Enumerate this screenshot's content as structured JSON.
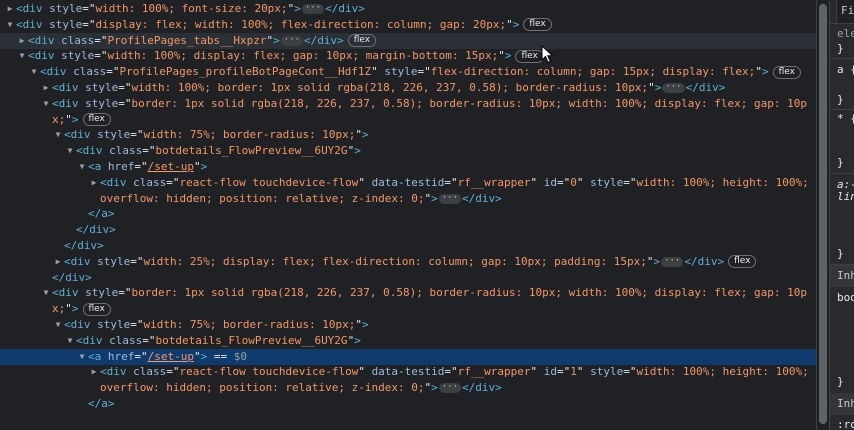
{
  "elements_tree": {
    "lines": [
      {
        "indent": 0,
        "arrow": "right",
        "parts": [
          {
            "t": "tag",
            "v": "<div "
          },
          {
            "t": "an",
            "v": "style"
          },
          {
            "t": "eq",
            "v": "=\""
          },
          {
            "t": "av",
            "v": "width: 100%; font-size: 20px;"
          },
          {
            "t": "eq",
            "v": "\""
          },
          {
            "t": "tag",
            "v": ">"
          },
          {
            "t": "ell",
            "v": "···"
          },
          {
            "t": "tag",
            "v": "</div>"
          }
        ]
      },
      {
        "indent": 0,
        "arrow": "down",
        "parts": [
          {
            "t": "tag",
            "v": "<div "
          },
          {
            "t": "an",
            "v": "style"
          },
          {
            "t": "eq",
            "v": "=\""
          },
          {
            "t": "av",
            "v": "display: flex; width: 100%; flex-direction: column; gap: 20px;"
          },
          {
            "t": "eq",
            "v": "\""
          },
          {
            "t": "tag",
            "v": ">"
          },
          {
            "t": "badge",
            "v": "flex"
          }
        ]
      },
      {
        "indent": 1,
        "arrow": "right",
        "hover": true,
        "parts": [
          {
            "t": "tag",
            "v": "<div "
          },
          {
            "t": "an",
            "v": "class"
          },
          {
            "t": "eq",
            "v": "=\""
          },
          {
            "t": "av",
            "v": "ProfilePages_tabs__Hxpzr"
          },
          {
            "t": "eq",
            "v": "\""
          },
          {
            "t": "tag",
            "v": ">"
          },
          {
            "t": "ell",
            "v": "···"
          },
          {
            "t": "tag",
            "v": "</div>"
          },
          {
            "t": "badge",
            "v": "flex"
          }
        ]
      },
      {
        "indent": 1,
        "arrow": "down",
        "parts": [
          {
            "t": "tag",
            "v": "<div "
          },
          {
            "t": "an",
            "v": "style"
          },
          {
            "t": "eq",
            "v": "=\""
          },
          {
            "t": "av",
            "v": "width: 100%; display: flex; gap: 10px; margin-bottom: 15px;"
          },
          {
            "t": "eq",
            "v": "\""
          },
          {
            "t": "tag",
            "v": ">"
          },
          {
            "t": "badge",
            "v": "flex"
          }
        ]
      },
      {
        "indent": 2,
        "arrow": "down",
        "parts": [
          {
            "t": "tag",
            "v": "<div "
          },
          {
            "t": "an",
            "v": "class"
          },
          {
            "t": "eq",
            "v": "=\""
          },
          {
            "t": "av",
            "v": "ProfilePages_profileBotPageCont__Hdf1Z"
          },
          {
            "t": "eq",
            "v": "\" "
          },
          {
            "t": "an",
            "v": "style"
          },
          {
            "t": "eq",
            "v": "=\""
          },
          {
            "t": "av",
            "v": "flex-direction: column; gap: 15px; display: flex;"
          },
          {
            "t": "eq",
            "v": "\""
          },
          {
            "t": "tag",
            "v": ">"
          },
          {
            "t": "badge",
            "v": "flex"
          }
        ]
      },
      {
        "indent": 3,
        "arrow": "right",
        "parts": [
          {
            "t": "tag",
            "v": "<div "
          },
          {
            "t": "an",
            "v": "style"
          },
          {
            "t": "eq",
            "v": "=\""
          },
          {
            "t": "av",
            "v": "width: 100%; border: 1px solid rgba(218, 226, 237, 0.58); border-radius: 10px;"
          },
          {
            "t": "eq",
            "v": "\""
          },
          {
            "t": "tag",
            "v": ">"
          },
          {
            "t": "ell",
            "v": "···"
          },
          {
            "t": "tag",
            "v": "</div>"
          }
        ]
      },
      {
        "indent": 3,
        "arrow": "down",
        "parts": [
          {
            "t": "tag",
            "v": "<div "
          },
          {
            "t": "an",
            "v": "style"
          },
          {
            "t": "eq",
            "v": "=\""
          },
          {
            "t": "av",
            "v": "border: 1px solid rgba(218, 226, 237, 0.58); border-radius: 10px; width: 100%; display: flex; gap: 10p"
          }
        ]
      },
      {
        "indent": 3,
        "cont": true,
        "parts": [
          {
            "t": "av",
            "v": "x;"
          },
          {
            "t": "eq",
            "v": "\""
          },
          {
            "t": "tag",
            "v": ">"
          },
          {
            "t": "badge",
            "v": "flex"
          }
        ]
      },
      {
        "indent": 4,
        "arrow": "down",
        "parts": [
          {
            "t": "tag",
            "v": "<div "
          },
          {
            "t": "an",
            "v": "style"
          },
          {
            "t": "eq",
            "v": "=\""
          },
          {
            "t": "av",
            "v": "width: 75%; border-radius: 10px;"
          },
          {
            "t": "eq",
            "v": "\""
          },
          {
            "t": "tag",
            "v": ">"
          }
        ]
      },
      {
        "indent": 5,
        "arrow": "down",
        "parts": [
          {
            "t": "tag",
            "v": "<div "
          },
          {
            "t": "an",
            "v": "class"
          },
          {
            "t": "eq",
            "v": "=\""
          },
          {
            "t": "av",
            "v": "botdetails_FlowPreview__6UY2G"
          },
          {
            "t": "eq",
            "v": "\""
          },
          {
            "t": "tag",
            "v": ">"
          }
        ]
      },
      {
        "indent": 6,
        "arrow": "down",
        "parts": [
          {
            "t": "tag",
            "v": "<a "
          },
          {
            "t": "an",
            "v": "href"
          },
          {
            "t": "eq",
            "v": "=\""
          },
          {
            "t": "lnk",
            "v": "/set-up"
          },
          {
            "t": "eq",
            "v": "\""
          },
          {
            "t": "tag",
            "v": ">"
          }
        ]
      },
      {
        "indent": 7,
        "arrow": "right",
        "parts": [
          {
            "t": "tag",
            "v": "<div "
          },
          {
            "t": "an",
            "v": "class"
          },
          {
            "t": "eq",
            "v": "=\""
          },
          {
            "t": "av",
            "v": "react-flow touchdevice-flow"
          },
          {
            "t": "eq",
            "v": "\" "
          },
          {
            "t": "an",
            "v": "data-testid"
          },
          {
            "t": "eq",
            "v": "=\""
          },
          {
            "t": "av",
            "v": "rf__wrapper"
          },
          {
            "t": "eq",
            "v": "\" "
          },
          {
            "t": "an",
            "v": "id"
          },
          {
            "t": "eq",
            "v": "=\""
          },
          {
            "t": "av",
            "v": "0"
          },
          {
            "t": "eq",
            "v": "\" "
          },
          {
            "t": "an",
            "v": "style"
          },
          {
            "t": "eq",
            "v": "=\""
          },
          {
            "t": "av",
            "v": "width: 100%; height: 100%;"
          }
        ]
      },
      {
        "indent": 7,
        "cont": true,
        "parts": [
          {
            "t": "av",
            "v": "overflow: hidden; position: relative; z-index: 0;"
          },
          {
            "t": "eq",
            "v": "\""
          },
          {
            "t": "tag",
            "v": ">"
          },
          {
            "t": "ell",
            "v": "···"
          },
          {
            "t": "tag",
            "v": "</div>"
          }
        ]
      },
      {
        "indent": 6,
        "parts": [
          {
            "t": "tag",
            "v": "</a>"
          }
        ]
      },
      {
        "indent": 5,
        "parts": [
          {
            "t": "tag",
            "v": "</div>"
          }
        ]
      },
      {
        "indent": 4,
        "parts": [
          {
            "t": "tag",
            "v": "</div>"
          }
        ]
      },
      {
        "indent": 4,
        "arrow": "right",
        "parts": [
          {
            "t": "tag",
            "v": "<div "
          },
          {
            "t": "an",
            "v": "style"
          },
          {
            "t": "eq",
            "v": "=\""
          },
          {
            "t": "av",
            "v": "width: 25%; display: flex; flex-direction: column; gap: 10px; padding: 15px;"
          },
          {
            "t": "eq",
            "v": "\""
          },
          {
            "t": "tag",
            "v": ">"
          },
          {
            "t": "ell",
            "v": "···"
          },
          {
            "t": "tag",
            "v": "</div>"
          },
          {
            "t": "badge",
            "v": "flex"
          }
        ]
      },
      {
        "indent": 3,
        "parts": [
          {
            "t": "tag",
            "v": "</div>"
          }
        ]
      },
      {
        "indent": 3,
        "arrow": "down",
        "parts": [
          {
            "t": "tag",
            "v": "<div "
          },
          {
            "t": "an",
            "v": "style"
          },
          {
            "t": "eq",
            "v": "=\""
          },
          {
            "t": "av",
            "v": "border: 1px solid rgba(218, 226, 237, 0.58); border-radius: 10px; width: 100%; display: flex; gap: 10p"
          }
        ]
      },
      {
        "indent": 3,
        "cont": true,
        "parts": [
          {
            "t": "av",
            "v": "x;"
          },
          {
            "t": "eq",
            "v": "\""
          },
          {
            "t": "tag",
            "v": ">"
          },
          {
            "t": "badge",
            "v": "flex"
          }
        ]
      },
      {
        "indent": 4,
        "arrow": "down",
        "parts": [
          {
            "t": "tag",
            "v": "<div "
          },
          {
            "t": "an",
            "v": "style"
          },
          {
            "t": "eq",
            "v": "=\""
          },
          {
            "t": "av",
            "v": "width: 75%; border-radius: 10px;"
          },
          {
            "t": "eq",
            "v": "\""
          },
          {
            "t": "tag",
            "v": ">"
          }
        ]
      },
      {
        "indent": 5,
        "arrow": "down",
        "parts": [
          {
            "t": "tag",
            "v": "<div "
          },
          {
            "t": "an",
            "v": "class"
          },
          {
            "t": "eq",
            "v": "=\""
          },
          {
            "t": "av",
            "v": "botdetails_FlowPreview__6UY2G"
          },
          {
            "t": "eq",
            "v": "\""
          },
          {
            "t": "tag",
            "v": ">"
          }
        ]
      },
      {
        "indent": 6,
        "arrow": "down",
        "selected": true,
        "parts": [
          {
            "t": "tag",
            "v": "<a "
          },
          {
            "t": "an",
            "v": "href"
          },
          {
            "t": "eq",
            "v": "=\""
          },
          {
            "t": "lnk",
            "v": "/set-up"
          },
          {
            "t": "eq",
            "v": "\""
          },
          {
            "t": "tag",
            "v": ">"
          },
          {
            "t": "txt",
            "v": " == "
          },
          {
            "t": "dim",
            "v": "$0"
          }
        ]
      },
      {
        "indent": 7,
        "arrow": "right",
        "parts": [
          {
            "t": "tag",
            "v": "<div "
          },
          {
            "t": "an",
            "v": "class"
          },
          {
            "t": "eq",
            "v": "=\""
          },
          {
            "t": "av",
            "v": "react-flow touchdevice-flow"
          },
          {
            "t": "eq",
            "v": "\" "
          },
          {
            "t": "an",
            "v": "data-testid"
          },
          {
            "t": "eq",
            "v": "=\""
          },
          {
            "t": "av",
            "v": "rf__wrapper"
          },
          {
            "t": "eq",
            "v": "\" "
          },
          {
            "t": "an",
            "v": "id"
          },
          {
            "t": "eq",
            "v": "=\""
          },
          {
            "t": "av",
            "v": "1"
          },
          {
            "t": "eq",
            "v": "\" "
          },
          {
            "t": "an",
            "v": "style"
          },
          {
            "t": "eq",
            "v": "=\""
          },
          {
            "t": "av",
            "v": "width: 100%; height: 100%;"
          }
        ]
      },
      {
        "indent": 7,
        "cont": true,
        "parts": [
          {
            "t": "av",
            "v": "overflow: hidden; position: relative; z-index: 0;"
          },
          {
            "t": "eq",
            "v": "\""
          },
          {
            "t": "tag",
            "v": ">"
          },
          {
            "t": "ell",
            "v": "···"
          },
          {
            "t": "tag",
            "v": "</div>"
          }
        ]
      },
      {
        "indent": 6,
        "parts": [
          {
            "t": "tag",
            "v": "</a>"
          }
        ]
      }
    ]
  },
  "styles_panel": {
    "filter_label": "Filt",
    "element_label": "ele",
    "brace_close": "}",
    "rule_a": "a {",
    "rule_star": "* {",
    "rule_a2": "a:-",
    "rule_a2_line2": "lin",
    "inherited_label": "Inh",
    "inherited_prop": "bod",
    "inherited_label2": "Inh",
    "partial_text": ":ro"
  },
  "colors": {
    "background": "#202124",
    "tag": "#5db0d7",
    "attr_name": "#9bbbdc",
    "attr_value": "#f29766",
    "selected_row": "#0e3a6e"
  }
}
